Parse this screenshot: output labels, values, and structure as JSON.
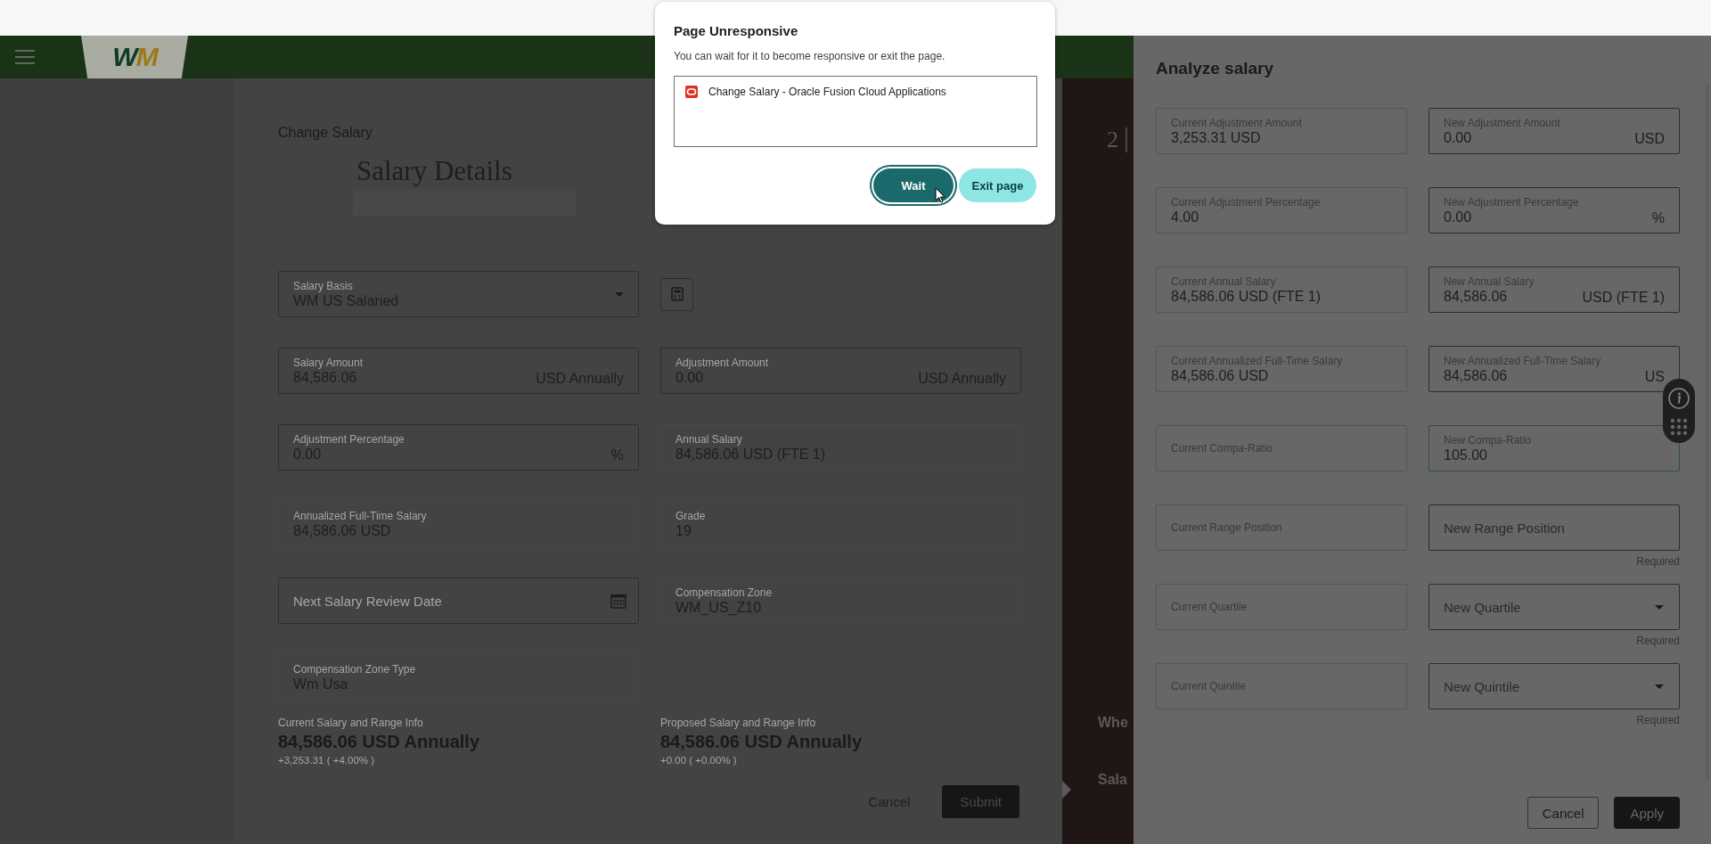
{
  "header": {
    "logo": "WM"
  },
  "page": {
    "heading": "Change Salary",
    "section_title": "Salary Details",
    "rows": [
      [
        {
          "kind": "select",
          "label": "Salary Basis",
          "value": "WM US Salaried"
        },
        {
          "kind": "icon-button"
        }
      ],
      [
        {
          "kind": "editable",
          "label": "Salary Amount",
          "value": "84,586.06",
          "suffix": "USD Annually"
        },
        {
          "kind": "editable",
          "label": "Adjustment Amount",
          "value": "0.00",
          "suffix": "USD Annually"
        }
      ],
      [
        {
          "kind": "editable",
          "label": "Adjustment Percentage",
          "value": "0.00",
          "suffix": "%"
        },
        {
          "kind": "readonly",
          "label": "Annual Salary",
          "value": "84,586.06 USD (FTE 1)"
        }
      ],
      [
        {
          "kind": "readonly",
          "label": "Annualized Full-Time Salary",
          "value": "84,586.06 USD"
        },
        {
          "kind": "readonly",
          "label": "Grade",
          "value": "19"
        }
      ],
      [
        {
          "kind": "date",
          "placeholder": "Next Salary Review Date"
        },
        {
          "kind": "readonly",
          "label": "Compensation Zone",
          "value": "WM_US_Z10"
        }
      ],
      [
        {
          "kind": "readonly",
          "label": "Compensation Zone Type",
          "value": "Wm Usa"
        }
      ]
    ],
    "summary": [
      {
        "label": "Current Salary and Range Info",
        "amount": "84,586.06 USD Annually",
        "change": "+3,253.31 ( +4.00% )"
      },
      {
        "label": "Proposed Salary and Range Info",
        "amount": "84,586.06 USD Annually",
        "change": "+0.00 ( +0.00% )"
      }
    ],
    "buttons": [
      {
        "label": "Cancel",
        "kind": "secondary"
      },
      {
        "label": "Submit",
        "kind": "primary"
      }
    ]
  },
  "side_strip": {
    "step": "2",
    "items": [
      "Whe",
      "Sala"
    ]
  },
  "analyze": {
    "title": "Analyze salary",
    "rows": [
      {
        "current": {
          "label": "Current Adjustment Amount",
          "value": "3,253.31 USD"
        },
        "new": {
          "kind": "editable",
          "label": "New Adjustment Amount",
          "value": "0.00",
          "suffix": "USD"
        }
      },
      {
        "current": {
          "label": "Current Adjustment Percentage",
          "value": "4.00"
        },
        "new": {
          "kind": "editable",
          "label": "New Adjustment Percentage",
          "value": "0.00",
          "suffix": "%"
        }
      },
      {
        "current": {
          "label": "Current Annual Salary",
          "value": "84,586.06 USD (FTE 1)"
        },
        "new": {
          "kind": "editable",
          "label": "New Annual Salary",
          "value": "84,586.06",
          "suffix": "USD (FTE 1)"
        }
      },
      {
        "current": {
          "label": "Current Annualized Full-Time Salary",
          "value": "84,586.06 USD"
        },
        "new": {
          "kind": "editable",
          "label": "New Annualized Full-Time Salary",
          "value": "84,586.06",
          "suffix": "US"
        }
      },
      {
        "current": {
          "label": "Current Compa-Ratio"
        },
        "new": {
          "kind": "focused",
          "label": "New Compa-Ratio",
          "value": "105.00"
        }
      },
      {
        "current": {
          "label": "Current Range Position"
        },
        "new": {
          "kind": "editable",
          "placeholder": "New Range Position",
          "helper": "Required"
        }
      },
      {
        "current": {
          "label": "Current Quartile"
        },
        "new": {
          "kind": "select",
          "placeholder": "New Quartile",
          "helper": "Required"
        }
      },
      {
        "current": {
          "label": "Current Quintile"
        },
        "new": {
          "kind": "select",
          "placeholder": "New Quintile",
          "helper": "Required"
        }
      }
    ],
    "buttons": [
      {
        "label": "Cancel",
        "kind": "secondary"
      },
      {
        "label": "Apply",
        "kind": "primary"
      }
    ]
  },
  "dialog": {
    "title": "Page Unresponsive",
    "message": "You can wait for it to become responsive or exit the page.",
    "entry": "Change Salary - Oracle Fusion Cloud Applications",
    "buttons": [
      {
        "label": "Wait",
        "kind": "primary"
      },
      {
        "label": "Exit page",
        "kind": "secondary"
      }
    ]
  }
}
